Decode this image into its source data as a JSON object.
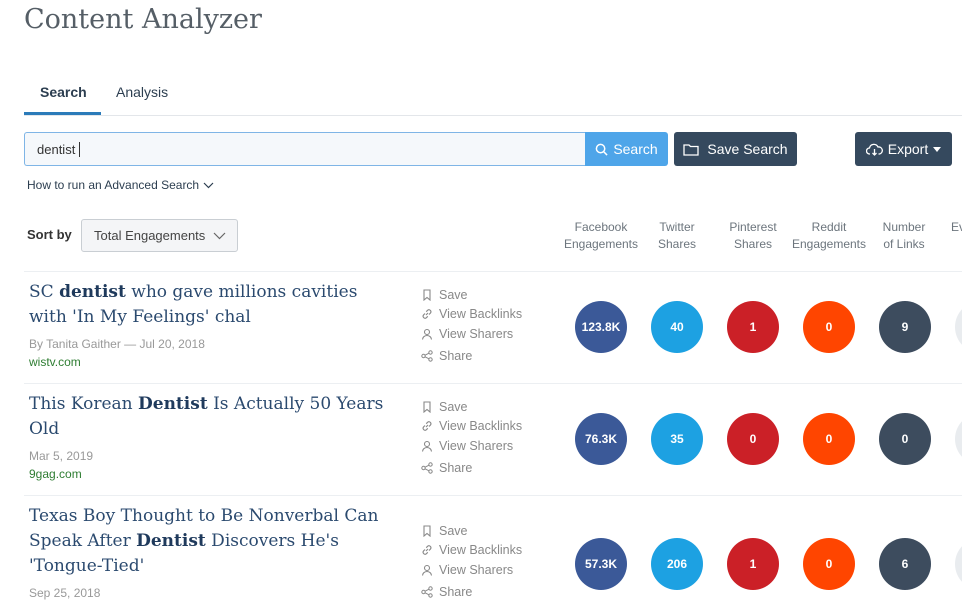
{
  "page_title": "Content Analyzer",
  "tabs": [
    {
      "label": "Search",
      "active": true
    },
    {
      "label": "Analysis",
      "active": false
    }
  ],
  "search": {
    "value": "dentist",
    "button_label": "Search"
  },
  "save_search_label": "Save Search",
  "export_label": "Export",
  "advanced_search_link": "How to run an Advanced Search",
  "sort": {
    "label": "Sort by",
    "selected": "Total Engagements"
  },
  "columns": [
    {
      "line1": "Facebook",
      "line2": "Engagements"
    },
    {
      "line1": "Twitter",
      "line2": "Shares"
    },
    {
      "line1": "Pinterest",
      "line2": "Shares"
    },
    {
      "line1": "Reddit",
      "line2": "Engagements"
    },
    {
      "line1": "Number",
      "line2": "of Links"
    },
    {
      "line1": "Ev",
      "line2": ""
    }
  ],
  "actions": {
    "save": "Save",
    "backlinks": "View Backlinks",
    "sharers": "View Sharers",
    "share": "Share"
  },
  "results": [
    {
      "title_parts": [
        "SC ",
        "dentist",
        " who gave millions cavities with 'In My Feelings' chal"
      ],
      "byline": "By Tanita Gaither — Jul 20, 2018",
      "domain": "wistv.com",
      "facebook": "123.8K",
      "twitter": "40",
      "pinterest": "1",
      "reddit": "0",
      "links": "9"
    },
    {
      "title_parts": [
        "This Korean ",
        "Dentist",
        " Is Actually 50 Years Old"
      ],
      "byline": "Mar 5, 2019",
      "domain": "9gag.com",
      "facebook": "76.3K",
      "twitter": "35",
      "pinterest": "0",
      "reddit": "0",
      "links": "0"
    },
    {
      "title_parts": [
        "Texas Boy Thought to Be Nonverbal Can Speak After ",
        "Dentist",
        " Discovers He's 'Tongue-Tied'"
      ],
      "byline": "Sep 25, 2018",
      "domain": "",
      "facebook": "57.3K",
      "twitter": "206",
      "pinterest": "1",
      "reddit": "0",
      "links": "6"
    }
  ],
  "colors": {
    "facebook": "#3b5998",
    "twitter": "#1da1e2",
    "pinterest": "#cb2027",
    "reddit": "#ff4500",
    "links": "#3d4c5e",
    "primary_button": "#4ea5e9",
    "dark_button": "#35495e",
    "domain_green": "#2e7d32"
  },
  "icons": [
    "search-icon",
    "folder-icon",
    "cloud-download-icon",
    "caret-down-icon",
    "chevron-down-icon",
    "bookmark-icon",
    "link-icon",
    "user-icon",
    "share-icon"
  ]
}
